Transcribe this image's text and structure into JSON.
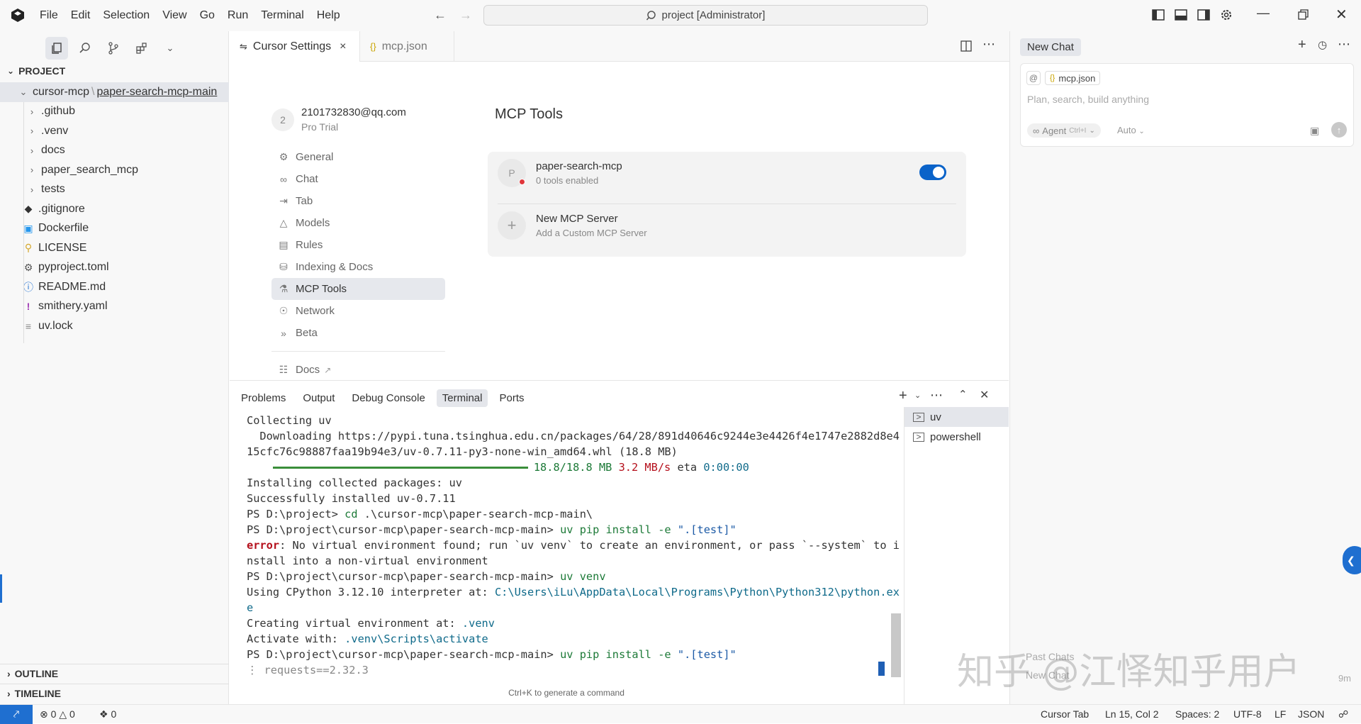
{
  "titlebar": {
    "menu": [
      "File",
      "Edit",
      "Selection",
      "View",
      "Go",
      "Run",
      "Terminal",
      "Help"
    ],
    "search_text": "project [Administrator]"
  },
  "sidebar": {
    "explorer_title": "PROJECT",
    "root_path_a": "cursor-mcp",
    "root_path_sep": "\\",
    "root_path_b": "paper-search-mcp-main",
    "folders": [
      ".github",
      ".venv",
      "docs",
      "paper_search_mcp",
      "tests"
    ],
    "files": [
      {
        "name": ".gitignore",
        "icon": "git-icon",
        "color": "#333333"
      },
      {
        "name": "Dockerfile",
        "icon": "docker-icon",
        "color": "#2496ed"
      },
      {
        "name": "LICENSE",
        "icon": "license-icon",
        "color": "#d4a72c"
      },
      {
        "name": "pyproject.toml",
        "icon": "gear-icon",
        "color": "#555555"
      },
      {
        "name": "README.md",
        "icon": "info-icon",
        "color": "#1f6fd0"
      },
      {
        "name": "smithery.yaml",
        "icon": "yaml-icon",
        "color": "#a03bb5"
      },
      {
        "name": "uv.lock",
        "icon": "lines-icon",
        "color": "#888888"
      }
    ],
    "outline": "OUTLINE",
    "timeline": "TIMELINE"
  },
  "editor_tabs": [
    {
      "label": "Cursor Settings",
      "active": true
    },
    {
      "label": "mcp.json",
      "active": false
    }
  ],
  "settings": {
    "avatar_letter": "2",
    "email": "2101732830@qq.com",
    "plan": "Pro Trial",
    "nav": [
      {
        "label": "General",
        "icon": "gear-icon"
      },
      {
        "label": "Chat",
        "icon": "infinity-icon"
      },
      {
        "label": "Tab",
        "icon": "tab-icon"
      },
      {
        "label": "Models",
        "icon": "cube-icon"
      },
      {
        "label": "Rules",
        "icon": "clipboard-icon"
      },
      {
        "label": "Indexing & Docs",
        "icon": "database-icon"
      },
      {
        "label": "MCP Tools",
        "icon": "mcp-icon",
        "active": true
      },
      {
        "label": "Network",
        "icon": "globe-icon"
      },
      {
        "label": "Beta",
        "icon": "beta-icon"
      }
    ],
    "docs_label": "Docs",
    "page_title": "MCP Tools",
    "servers": [
      {
        "letter": "P",
        "name": "paper-search-mcp",
        "subtitle": "0 tools enabled",
        "enabled": true,
        "status_color": "#e0363b"
      }
    ],
    "new_server": {
      "name": "New MCP Server",
      "subtitle": "Add a Custom MCP Server"
    }
  },
  "panel": {
    "tabs": [
      "Problems",
      "Output",
      "Debug Console",
      "Terminal",
      "Ports"
    ],
    "active_tab": "Terminal",
    "terminals": [
      "uv",
      "powershell"
    ],
    "lines": {
      "l1": "Collecting uv",
      "l2": "  Downloading https://pypi.tuna.tsinghua.edu.cn/packages/64/28/891d40646c9244e3e4426f4e1747e2882d8e4",
      "l3": "15cfc76c98887faa19b94e3/uv-0.7.11-py3-none-win_amd64.whl (18.8 MB)",
      "l4_progress": "18.8/18.8 MB",
      "l4_speed": "3.2 MB/s",
      "l4_eta_label": "eta",
      "l4_eta": "0:00:00",
      "l5": "Installing collected packages: uv",
      "l6": "Successfully installed uv-0.7.11",
      "l7_prompt": "PS D:\\project>",
      "l7_cmd": "cd",
      "l7_arg": ".\\cursor-mcp\\paper-search-mcp-main\\",
      "l8_prompt": "PS D:\\project\\cursor-mcp\\paper-search-mcp-main>",
      "l8_cmd": "uv pip install -e",
      "l8_arg": "\".[test]\"",
      "l9_err": "error",
      "l9_text": ": No virtual environment found; run `uv venv` to create an environment, or pass `--system` to i",
      "l10": "nstall into a non-virtual environment",
      "l11_prompt": "PS D:\\project\\cursor-mcp\\paper-search-mcp-main>",
      "l11_cmd": "uv venv",
      "l12_text": "Using CPython 3.12.10 interpreter at: ",
      "l12_path": "C:\\Users\\iLu\\AppData\\Local\\Programs\\Python\\Python312\\python.ex",
      "l13": "e",
      "l14_text": "Creating virtual environment at: ",
      "l14_path": ".venv",
      "l15_text": "Activate with: ",
      "l15_path": ".venv\\Scripts\\activate",
      "l16_prompt": "PS D:\\project\\cursor-mcp\\paper-search-mcp-main>",
      "l16_cmd": "uv pip install -e",
      "l16_arg": "\".[test]\"",
      "l17": "⋮ requests==2.32.3"
    },
    "hint": "Ctrl+K to generate a command"
  },
  "chat": {
    "tab": "New Chat",
    "file_chip": "mcp.json",
    "placeholder": "Plan, search, build anything",
    "agent_label": "Agent",
    "agent_shortcut": "Ctrl+I",
    "model": "Auto",
    "history_1": "Past Chats",
    "history_2": "New Chat",
    "time": "9m",
    "watermark": "知乎 @江怿知乎用户"
  },
  "statusbar": {
    "errors": "0",
    "warnings": "0",
    "ports": "0",
    "cursor_tab": "Cursor Tab",
    "position": "Ln 15, Col 2",
    "spaces": "Spaces: 2",
    "encoding": "UTF-8",
    "eol": "LF",
    "language": "JSON"
  },
  "colors": {
    "accent": "#1f6fd0",
    "toggle": "#0a63c9",
    "progress": "#3a8e3a"
  }
}
